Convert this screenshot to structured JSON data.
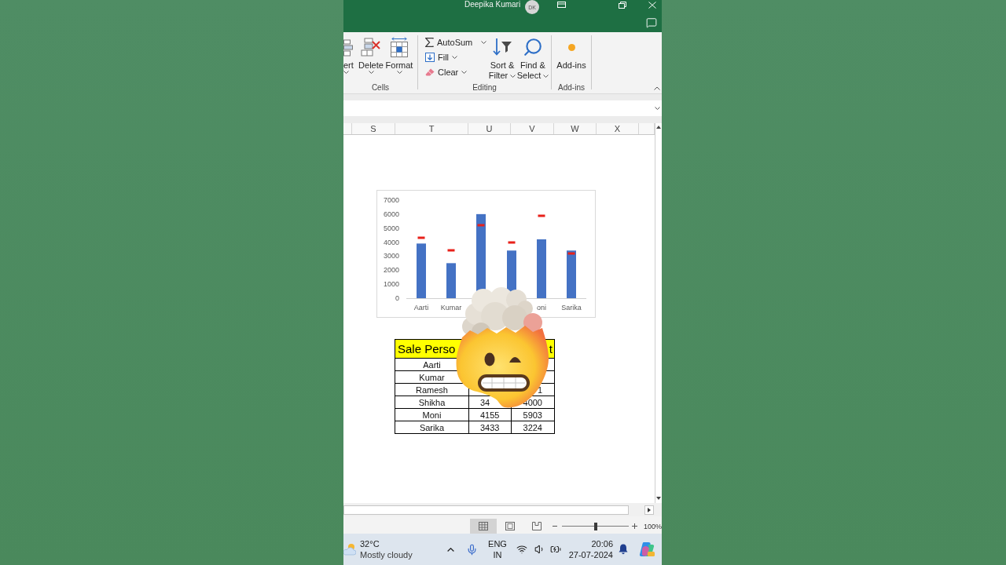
{
  "title_bar": {
    "user_name": "Deepika Kumari",
    "avatar_initials": "DK"
  },
  "ribbon": {
    "cells": {
      "label": "Cells",
      "buttons": [
        {
          "kind": "insert",
          "label": "ert"
        },
        {
          "kind": "delete",
          "label": "Delete"
        },
        {
          "kind": "format",
          "label": "Format"
        }
      ]
    },
    "editing": {
      "label": "Editing",
      "small_buttons": [
        {
          "kind": "autosum",
          "label": "AutoSum"
        },
        {
          "kind": "fill",
          "label": "Fill"
        },
        {
          "kind": "clear",
          "label": "Clear"
        }
      ],
      "large_buttons": [
        {
          "kind": "sort_filter",
          "lines": [
            "Sort &",
            "Filter"
          ]
        },
        {
          "kind": "find_select",
          "lines": [
            "Find &",
            "Select"
          ]
        }
      ]
    },
    "add_ins": {
      "label": "Add-ins",
      "buttons": [
        {
          "kind": "add_ins",
          "label": "Add-ins"
        }
      ]
    }
  },
  "sheet": {
    "columns": [
      "S",
      "T",
      "U",
      "V",
      "W",
      "X"
    ],
    "chart": {
      "chart_data": {
        "type": "bar",
        "categories": [
          "Aarti",
          "Kumar",
          null,
          null,
          "oni",
          "Sarika"
        ],
        "ylim": [
          0,
          7000
        ],
        "yticks": [
          0,
          1000,
          2000,
          3000,
          4000,
          5000,
          6000,
          7000
        ],
        "series": [
          {
            "type": "bar",
            "color": "#4472c4",
            "values": [
              3900,
              2500,
              6000,
              3400,
              4200,
              3400
            ]
          },
          {
            "type": "scatter",
            "color": "#e8211a",
            "values": [
              4300,
              3400,
              5200,
              4000,
              5900,
              3200
            ]
          }
        ]
      }
    },
    "table": {
      "header": {
        "column_1": "Sale Perso",
        "column_3": "t"
      },
      "rows": [
        {
          "column_1": "Aarti"
        },
        {
          "column_1": "Kumar"
        },
        {
          "column_1": "Ramesh",
          "column_3": "1"
        },
        {
          "column_1": "Shikha",
          "column_2": "34",
          "column_3": "4000"
        },
        {
          "column_1": "Moni",
          "column_2": "4155",
          "column_3": "5903"
        },
        {
          "column_1": "Sarika",
          "column_2": "3433",
          "column_3": "3224"
        }
      ]
    }
  },
  "status_bar": {
    "views": [
      {
        "kind": "normal",
        "selected": true
      },
      {
        "kind": "page_layout",
        "selected": false
      },
      {
        "kind": "page_break_preview",
        "selected": false
      }
    ],
    "zoom": {
      "level": 0.5,
      "reading": "100%"
    }
  },
  "taskbar": {
    "weather": {
      "temperature": "32°C",
      "condition": "Mostly cloudy"
    },
    "language": {
      "code": "ENG",
      "region": "IN"
    },
    "clock": {
      "time": "20:06",
      "date": "27-07-2024"
    }
  }
}
